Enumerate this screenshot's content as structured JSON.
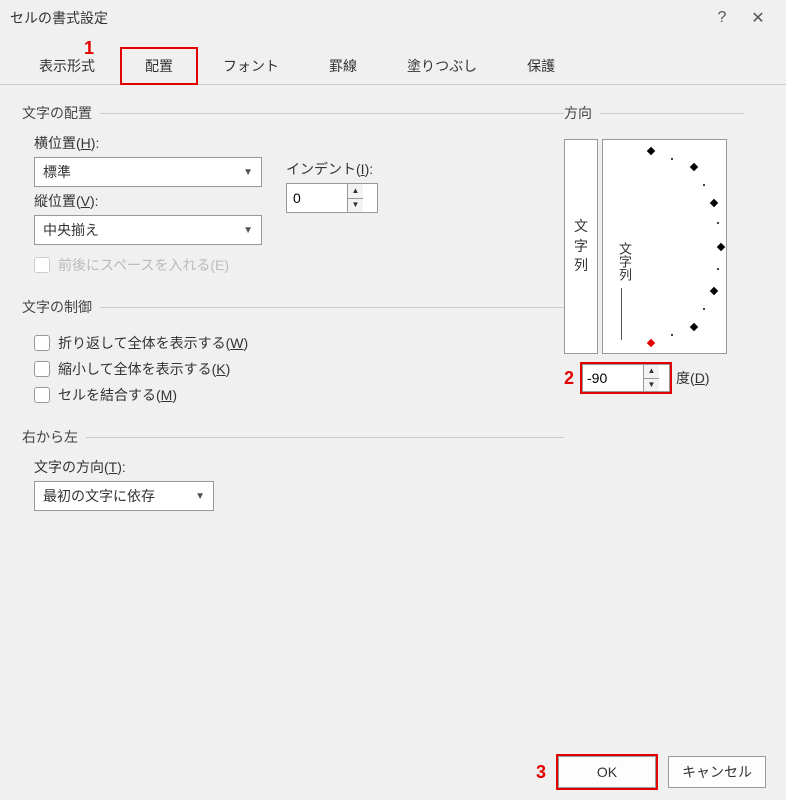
{
  "window": {
    "title": "セルの書式設定",
    "help": "?",
    "close": "✕"
  },
  "tabs": [
    "表示形式",
    "配置",
    "フォント",
    "罫線",
    "塗りつぶし",
    "保護"
  ],
  "active_tab": "配置",
  "alignment": {
    "legend": "文字の配置",
    "horiz_label_pre": "横位置(",
    "horiz_key": "H",
    "horiz_label_post": "):",
    "horiz_value": "標準",
    "vert_label_pre": "縦位置(",
    "vert_key": "V",
    "vert_label_post": "):",
    "vert_value": "中央揃え",
    "indent_label_pre": "インデント(",
    "indent_key": "I",
    "indent_label_post": "):",
    "indent_value": "0",
    "space_label": "前後にスペースを入れる(E)"
  },
  "control": {
    "legend": "文字の制御",
    "wrap_pre": "折り返して全体を表示する(",
    "wrap_key": "W",
    "wrap_post": ")",
    "shrink_pre": "縮小して全体を表示する(",
    "shrink_key": "K",
    "shrink_post": ")",
    "merge_pre": "セルを結合する(",
    "merge_key": "M",
    "merge_post": ")"
  },
  "rtl": {
    "legend": "右から左",
    "dir_label_pre": "文字の方向(",
    "dir_key": "T",
    "dir_label_post": "):",
    "dir_value": "最初の文字に依存"
  },
  "orientation": {
    "legend": "方向",
    "vert_text": "文字列",
    "dial_text": "文字列",
    "degree_value": "-90",
    "degree_label_pre": "度(",
    "degree_key": "D",
    "degree_label_post": ")"
  },
  "buttons": {
    "ok": "OK",
    "cancel": "キャンセル"
  },
  "annotations": {
    "a1": "1",
    "a2": "2",
    "a3": "3"
  }
}
